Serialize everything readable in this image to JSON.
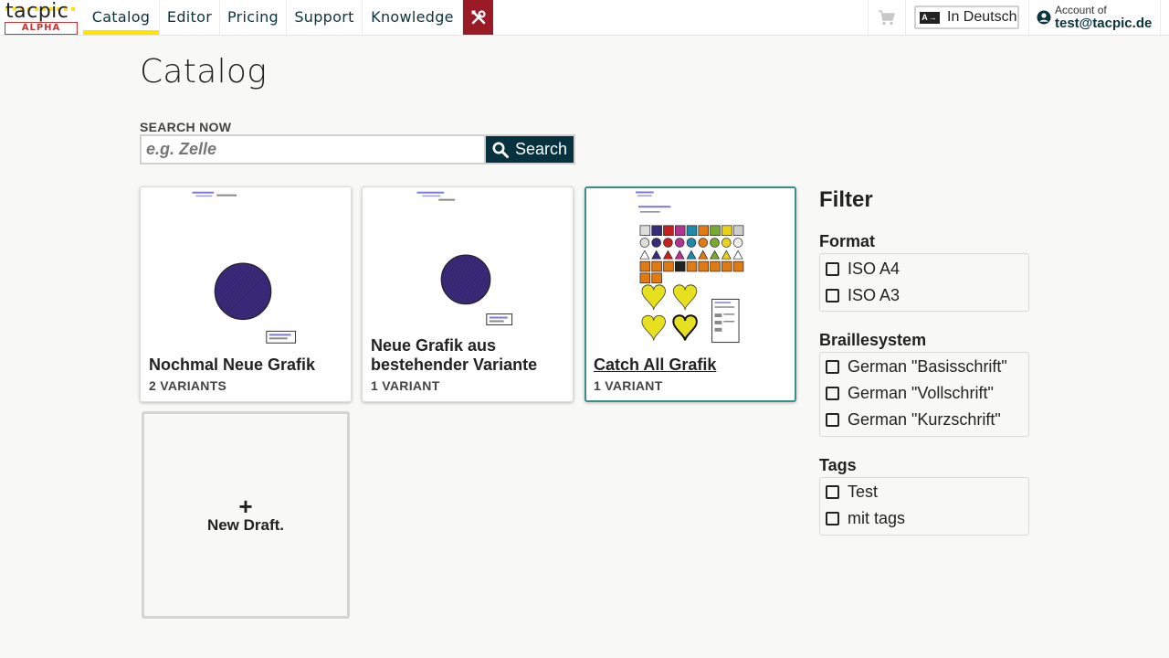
{
  "brand": {
    "logo_text": "tacpic",
    "badge": "ALPHA"
  },
  "nav": {
    "items": [
      {
        "label": "Catalog",
        "active": true
      },
      {
        "label": "Editor"
      },
      {
        "label": "Pricing"
      },
      {
        "label": "Support"
      },
      {
        "label": "Knowledge"
      }
    ],
    "tools_icon": "tools-icon",
    "cart_icon": "cart-icon",
    "language_label": "In Deutsch",
    "language_icon_text": "A→",
    "account_label": "Account of",
    "account_email": "test@tacpic.de"
  },
  "main": {
    "title": "Catalog",
    "search": {
      "label": "SEARCH NOW",
      "placeholder": "e.g. Zelle",
      "button_label": "Search"
    }
  },
  "cards": [
    {
      "title": "Nochmal Neue Grafik",
      "variants": "2 VARIANTS"
    },
    {
      "title": "Neue Grafik aus bestehender Variante",
      "variants": "1 VARIANT"
    },
    {
      "title": "Catch All Grafik",
      "variants": "1 VARIANT",
      "selected": true
    }
  ],
  "new_draft": {
    "plus": "+",
    "label": "New Draft."
  },
  "filter": {
    "title": "Filter",
    "groups": [
      {
        "label": "Format",
        "options": [
          "ISO A4",
          "ISO A3"
        ]
      },
      {
        "label": "Braillesystem",
        "options": [
          "German \"Basisschrift\"",
          "German \"Vollschrift\"",
          "German \"Kurzschrift\""
        ]
      },
      {
        "label": "Tags",
        "options": [
          "Test",
          "mit tags"
        ]
      }
    ]
  },
  "colors": {
    "nav_text": "#0b3340",
    "active_underline": "#ffe400",
    "tools_bg": "#9a1a25",
    "search_btn": "#06323f",
    "selected_border": "#3a8f8a",
    "circle_fill": "#3a2a7a"
  }
}
